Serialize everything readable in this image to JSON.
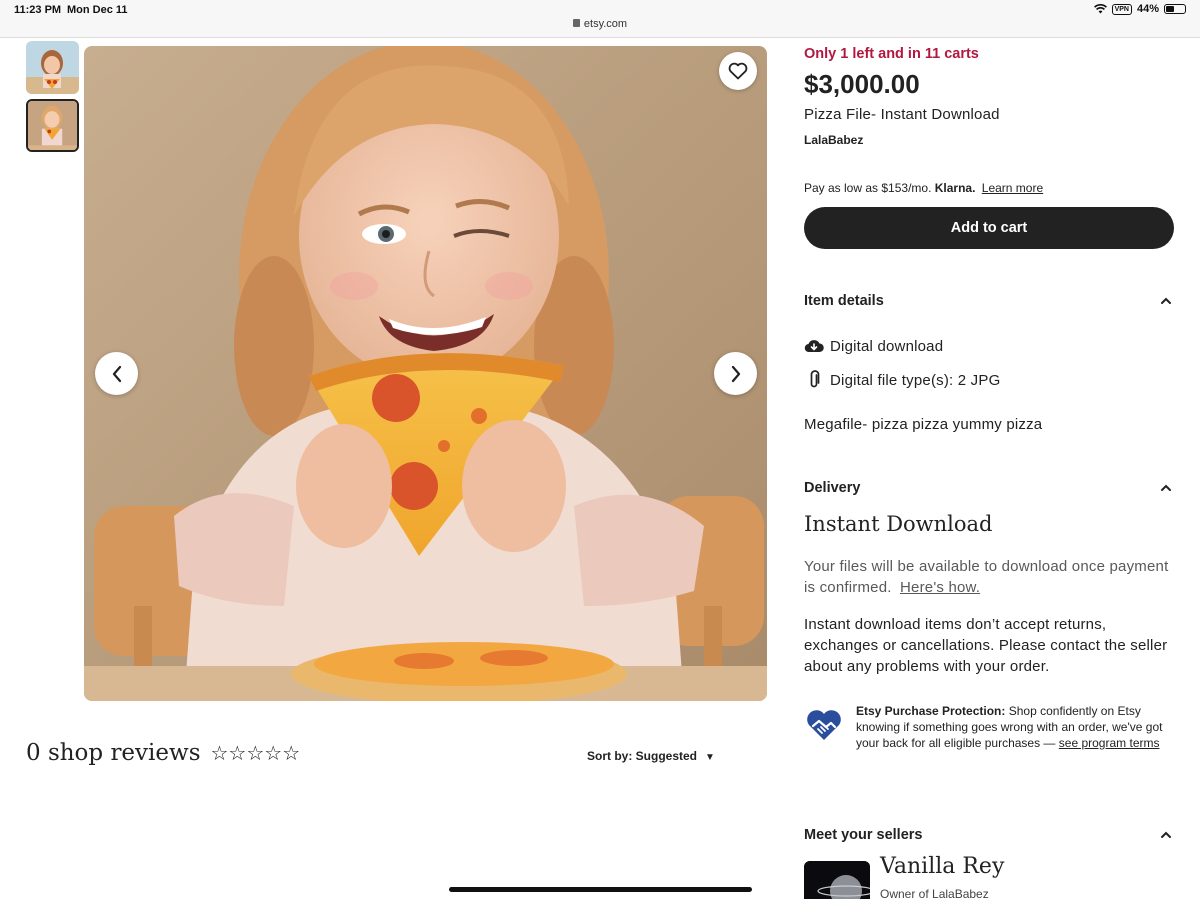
{
  "status_bar": {
    "time": "11:23 PM",
    "date": "Mon Dec 11",
    "url": "etsy.com",
    "vpn": "VPN",
    "battery": "44%",
    "battery_level": 0.44
  },
  "listing": {
    "stock_note": "Only 1 left and in 11 carts",
    "price": "$3,000.00",
    "title": "Pizza File- Instant Download",
    "shop_name": "LalaBabez",
    "klarna_text": "Pay as low as $153/mo.",
    "klarna_brand": "Klarna.",
    "klarna_link": "Learn more",
    "add_to_cart": "Add to cart"
  },
  "item_details": {
    "heading": "Item details",
    "rows": [
      {
        "icon": "cloud-download-icon",
        "text": "Digital download"
      },
      {
        "icon": "paperclip-icon",
        "text": "Digital file type(s): 2 JPG"
      }
    ],
    "description": "Megafile- pizza pizza yummy pizza"
  },
  "delivery": {
    "heading": "Delivery",
    "method": "Instant Download",
    "availability_text": "Your files will be available to download once payment is confirmed.",
    "availability_link": "Here's how.",
    "returns_text": "Instant download items don’t accept returns, exchanges or cancellations. Please contact the seller about any problems with your order.",
    "protection_title": "Etsy Purchase Protection:",
    "protection_text": "Shop confidently on Etsy knowing if something goes wrong with an order, we've got your back for all eligible purchases —",
    "protection_link": "see program terms"
  },
  "sellers": {
    "heading": "Meet your sellers",
    "name": "Vanilla Rey",
    "role": "Owner of LalaBabez"
  },
  "reviews": {
    "title": "0 shop reviews",
    "stars": "☆☆☆☆☆",
    "sort_label": "Sort by: Suggested",
    "sort_caret": "▼"
  },
  "gallery": {
    "thumbnails": [
      "thumbnail-1",
      "thumbnail-2"
    ],
    "selected_index": 1
  },
  "colors": {
    "stock_red": "#b3173f",
    "button_dark": "#222222",
    "protection_blue": "#2a4e9c"
  }
}
